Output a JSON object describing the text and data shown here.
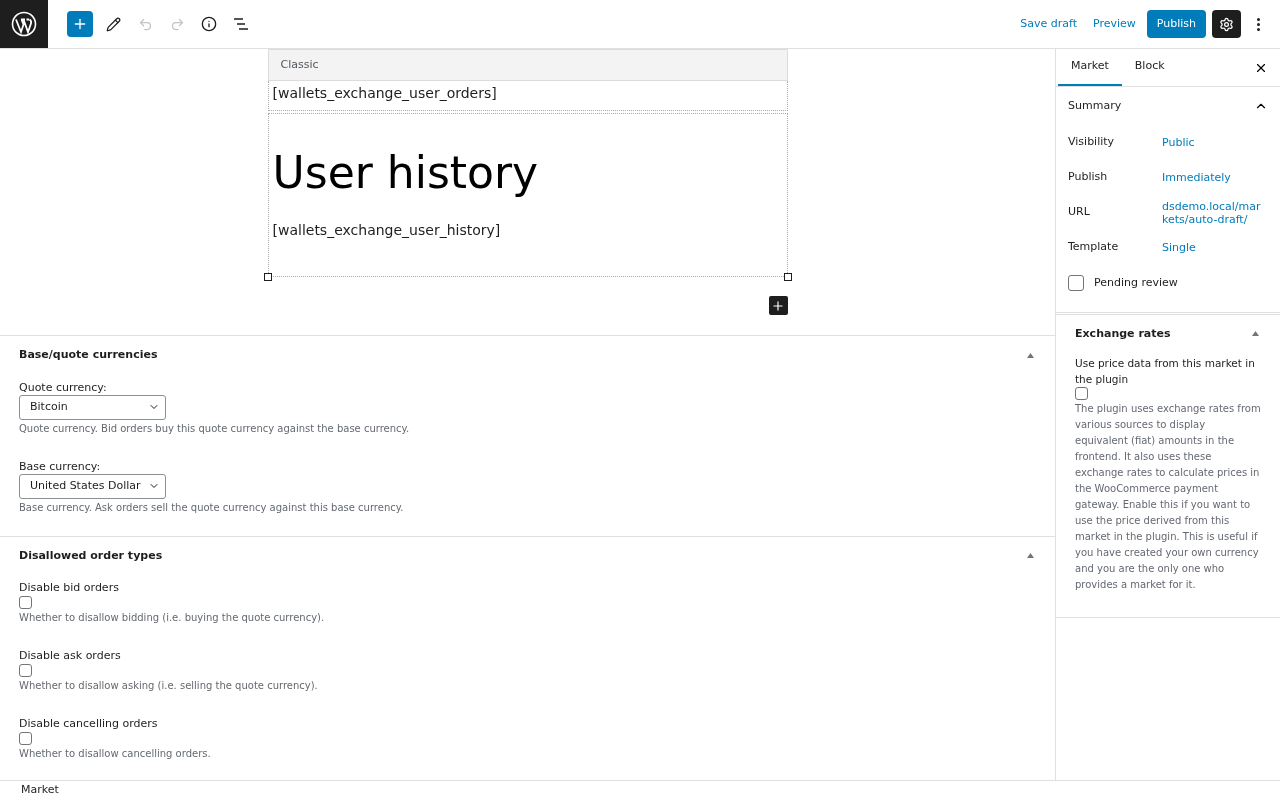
{
  "top_bar": {
    "tools": [
      {
        "kind": "add",
        "disabled": false
      },
      {
        "kind": "edit",
        "disabled": false
      },
      {
        "kind": "undo",
        "disabled": true
      },
      {
        "kind": "redo",
        "disabled": true
      },
      {
        "kind": "info",
        "disabled": false
      },
      {
        "kind": "outline",
        "disabled": false
      }
    ],
    "save_draft": "Save draft",
    "preview": "Preview",
    "publish": "Publish",
    "settings_selected": true
  },
  "editor": {
    "toolbar_label": "Classic",
    "shortcode_orders": "[wallets_exchange_user_orders]",
    "heading": "User history",
    "shortcode_history": "[wallets_exchange_user_history]"
  },
  "meta_boxes": [
    {
      "title": "Base/quote currencies",
      "expanded": true,
      "fields": [
        {
          "kind": "select",
          "label": "Quote currency:",
          "value": "Bitcoin",
          "description": "Quote currency. Bid orders buy this quote currency against the base currency."
        },
        {
          "kind": "select",
          "label": "Base currency:",
          "value": "United States Dollar",
          "description": "Base currency. Ask orders sell the quote currency against this base currency."
        }
      ]
    },
    {
      "title": "Disallowed order types",
      "expanded": true,
      "fields": [
        {
          "kind": "checkbox",
          "label": "Disable bid orders",
          "checked": false,
          "description": "Whether to disallow bidding (i.e. buying the quote currency)."
        },
        {
          "kind": "checkbox",
          "label": "Disable ask orders",
          "checked": false,
          "description": "Whether to disallow asking (i.e. selling the quote currency)."
        },
        {
          "kind": "checkbox",
          "label": "Disable cancelling orders",
          "checked": false,
          "description": "Whether to disallow cancelling orders."
        }
      ]
    }
  ],
  "sidebar": {
    "tabs": [
      {
        "label": "Market",
        "selected": true
      },
      {
        "label": "Block",
        "selected": false
      }
    ],
    "summary": {
      "title": "Summary",
      "expanded": true,
      "rows": [
        {
          "label": "Visibility",
          "value": "Public"
        },
        {
          "label": "Publish",
          "value": "Immediately"
        },
        {
          "label": "URL",
          "value": "dsdemo.local/markets/auto-draft/"
        },
        {
          "label": "Template",
          "value": "Single"
        }
      ],
      "pending_review": {
        "label": "Pending review",
        "checked": false
      }
    },
    "exchange_rates": {
      "title": "Exchange rates",
      "expanded": true,
      "field": {
        "label": "Use price data from this market in the plugin",
        "checked": false,
        "description": "The plugin uses exchange rates from various sources to display equivalent (fiat) amounts in the frontend. It also uses these exchange rates to calculate prices in the WooCommerce payment gateway. Enable this if you want to use the price derived from this market in the plugin. This is useful if you have created your own currency and you are the only one who provides a market for it."
      }
    }
  },
  "footer": {
    "breadcrumb": "Market"
  }
}
